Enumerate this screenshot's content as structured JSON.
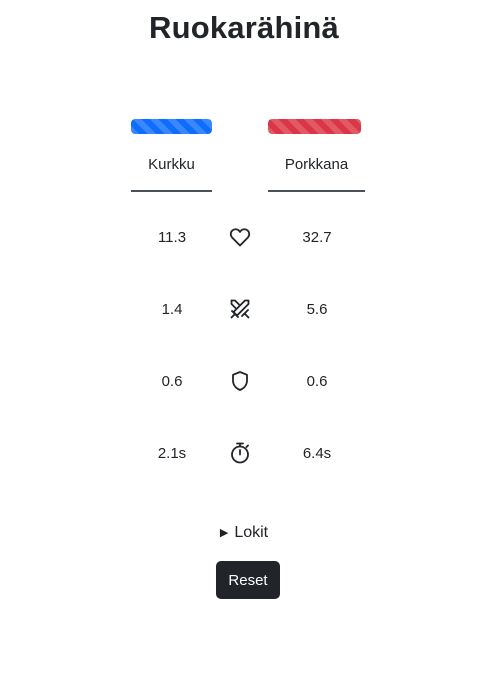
{
  "title": "Ruokarähinä",
  "fighters": {
    "left": {
      "name": "Kurkku",
      "hp_fraction": 1.0,
      "color": "#0d6efd"
    },
    "right": {
      "name": "Porkkana",
      "hp_fraction": 0.96,
      "color": "#dc3545"
    }
  },
  "stats": [
    {
      "icon": "heart-icon",
      "left": "11.3",
      "right": "32.7"
    },
    {
      "icon": "crossed-swords-icon",
      "left": "1.4",
      "right": "5.6"
    },
    {
      "icon": "shield-icon",
      "left": "0.6",
      "right": "0.6"
    },
    {
      "icon": "stopwatch-icon",
      "left": "2.1s",
      "right": "6.4s"
    }
  ],
  "logs": {
    "marker": "▶",
    "label": "Lokit"
  },
  "reset_label": "Reset"
}
